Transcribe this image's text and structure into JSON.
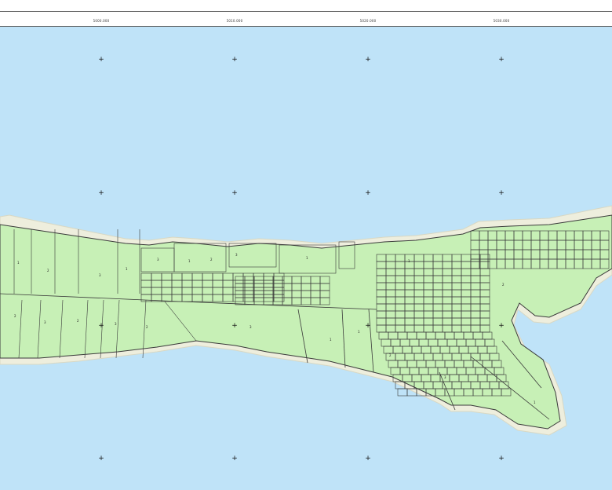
{
  "colors": {
    "water": "#bfe3f8",
    "beach": "#eeeedd",
    "parcel_fill": "#c7f0b6",
    "parcel_line": "#3a3a3a",
    "grid_mark": "#111111"
  },
  "map": {
    "top_coordinate_labels": [
      "5000.000",
      "5010.000",
      "5020.000",
      "5030.000"
    ],
    "graticule_symbol": "+",
    "parcel_labels": [
      "1",
      "2",
      "3",
      "1",
      "2",
      "3",
      "2",
      "3",
      "2",
      "1",
      "3",
      "1",
      "3",
      "1",
      "2",
      "3",
      "1",
      "2",
      "1",
      "3",
      "2",
      "1"
    ]
  }
}
